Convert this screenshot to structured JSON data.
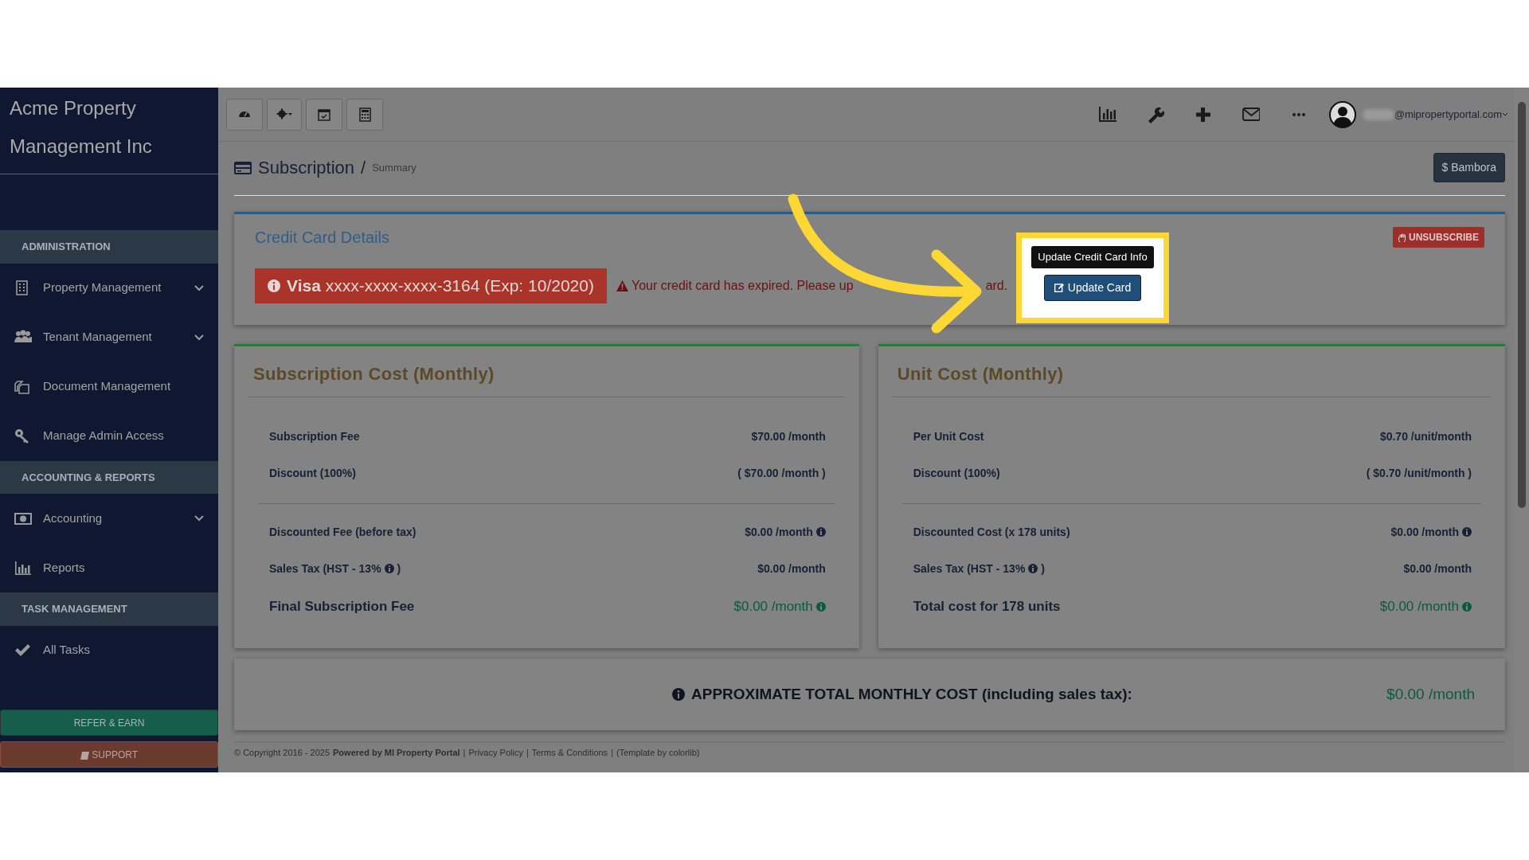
{
  "sidebar": {
    "brand": "Acme Property Management Inc",
    "sections": [
      {
        "heading": "ADMINISTRATION",
        "items": [
          {
            "label": "Property Management",
            "has_submenu": true
          },
          {
            "label": "Tenant Management",
            "has_submenu": true
          },
          {
            "label": "Document Management",
            "has_submenu": false
          },
          {
            "label": "Manage Admin Access",
            "has_submenu": false
          }
        ]
      },
      {
        "heading": "ACCOUNTING & REPORTS",
        "items": [
          {
            "label": "Accounting",
            "has_submenu": true
          },
          {
            "label": "Reports",
            "has_submenu": false
          }
        ]
      },
      {
        "heading": "TASK MANAGEMENT",
        "items": [
          {
            "label": "All Tasks",
            "has_submenu": false
          }
        ]
      }
    ],
    "buttons": [
      {
        "label": "REFER & EARN",
        "kind": "refer"
      },
      {
        "label": "SUPPORT",
        "kind": "support"
      }
    ]
  },
  "user": {
    "email": "@mipropertyportal.com"
  },
  "page": {
    "title": "Subscription",
    "separator": "/",
    "crumb": "Summary",
    "gateway_button": "$ Bambora"
  },
  "credit_card": {
    "title": "Credit Card Details",
    "unsubscribe": "UNSUBSCRIBE",
    "card_brand": "Visa",
    "card_number": "xxxx-xxxx-xxxx-3164 (Exp: 10/2020)",
    "warning_start": "Your credit card has expired. Please up",
    "warning_end": "ard.",
    "tooltip": "Update Credit Card Info",
    "update_button": "Update Card"
  },
  "cost_cards": [
    {
      "title": "Subscription Cost (Monthly)",
      "groups": [
        [
          {
            "label": "Subscription Fee",
            "value": "$70.00 /month",
            "kind": "line",
            "label_info": false,
            "value_info": false
          },
          {
            "label": "Discount (100%)",
            "value": "( $70.00 /month )",
            "kind": "line",
            "label_info": false,
            "value_info": false
          }
        ],
        [
          {
            "label": "Discounted Fee (before tax)",
            "value": "$0.00 /month",
            "kind": "line",
            "label_info": false,
            "value_info": true
          },
          {
            "label": "Sales Tax (HST - 13%",
            "label_end": ")",
            "value": "$0.00 /month",
            "kind": "line",
            "label_info": true,
            "value_info": false
          },
          {
            "label": "Final Subscription Fee",
            "value": "$0.00 /month",
            "kind": "total",
            "label_info": false,
            "value_info": true
          }
        ]
      ]
    },
    {
      "title": "Unit Cost (Monthly)",
      "groups": [
        [
          {
            "label": "Per Unit Cost",
            "value": "$0.70 /unit/month",
            "kind": "line",
            "label_info": false,
            "value_info": false
          },
          {
            "label": "Discount (100%)",
            "value": "( $0.70 /unit/month )",
            "kind": "line",
            "label_info": false,
            "value_info": false
          }
        ],
        [
          {
            "label": "Discounted Cost (x 178 units)",
            "value": "$0.00 /month",
            "kind": "line",
            "label_info": false,
            "value_info": true
          },
          {
            "label": "Sales Tax (HST - 13%",
            "label_end": ")",
            "value": "$0.00 /month",
            "kind": "line",
            "label_info": true,
            "value_info": false
          },
          {
            "label": "Total cost for 178 units",
            "value": "$0.00 /month",
            "kind": "total",
            "label_info": false,
            "value_info": true
          }
        ]
      ]
    }
  ],
  "total": {
    "label": "APPROXIMATE TOTAL MONTHLY COST (including sales tax):",
    "value": "$0.00 /month"
  },
  "footer": {
    "copyright": "© Copyright 2016 - 2025",
    "powered": "Powered by MI Property Portal",
    "links": [
      "Privacy Policy",
      "Terms & Conditions"
    ],
    "separators": [
      "|",
      "|",
      "|"
    ],
    "template": "(Template by colorlib)"
  }
}
